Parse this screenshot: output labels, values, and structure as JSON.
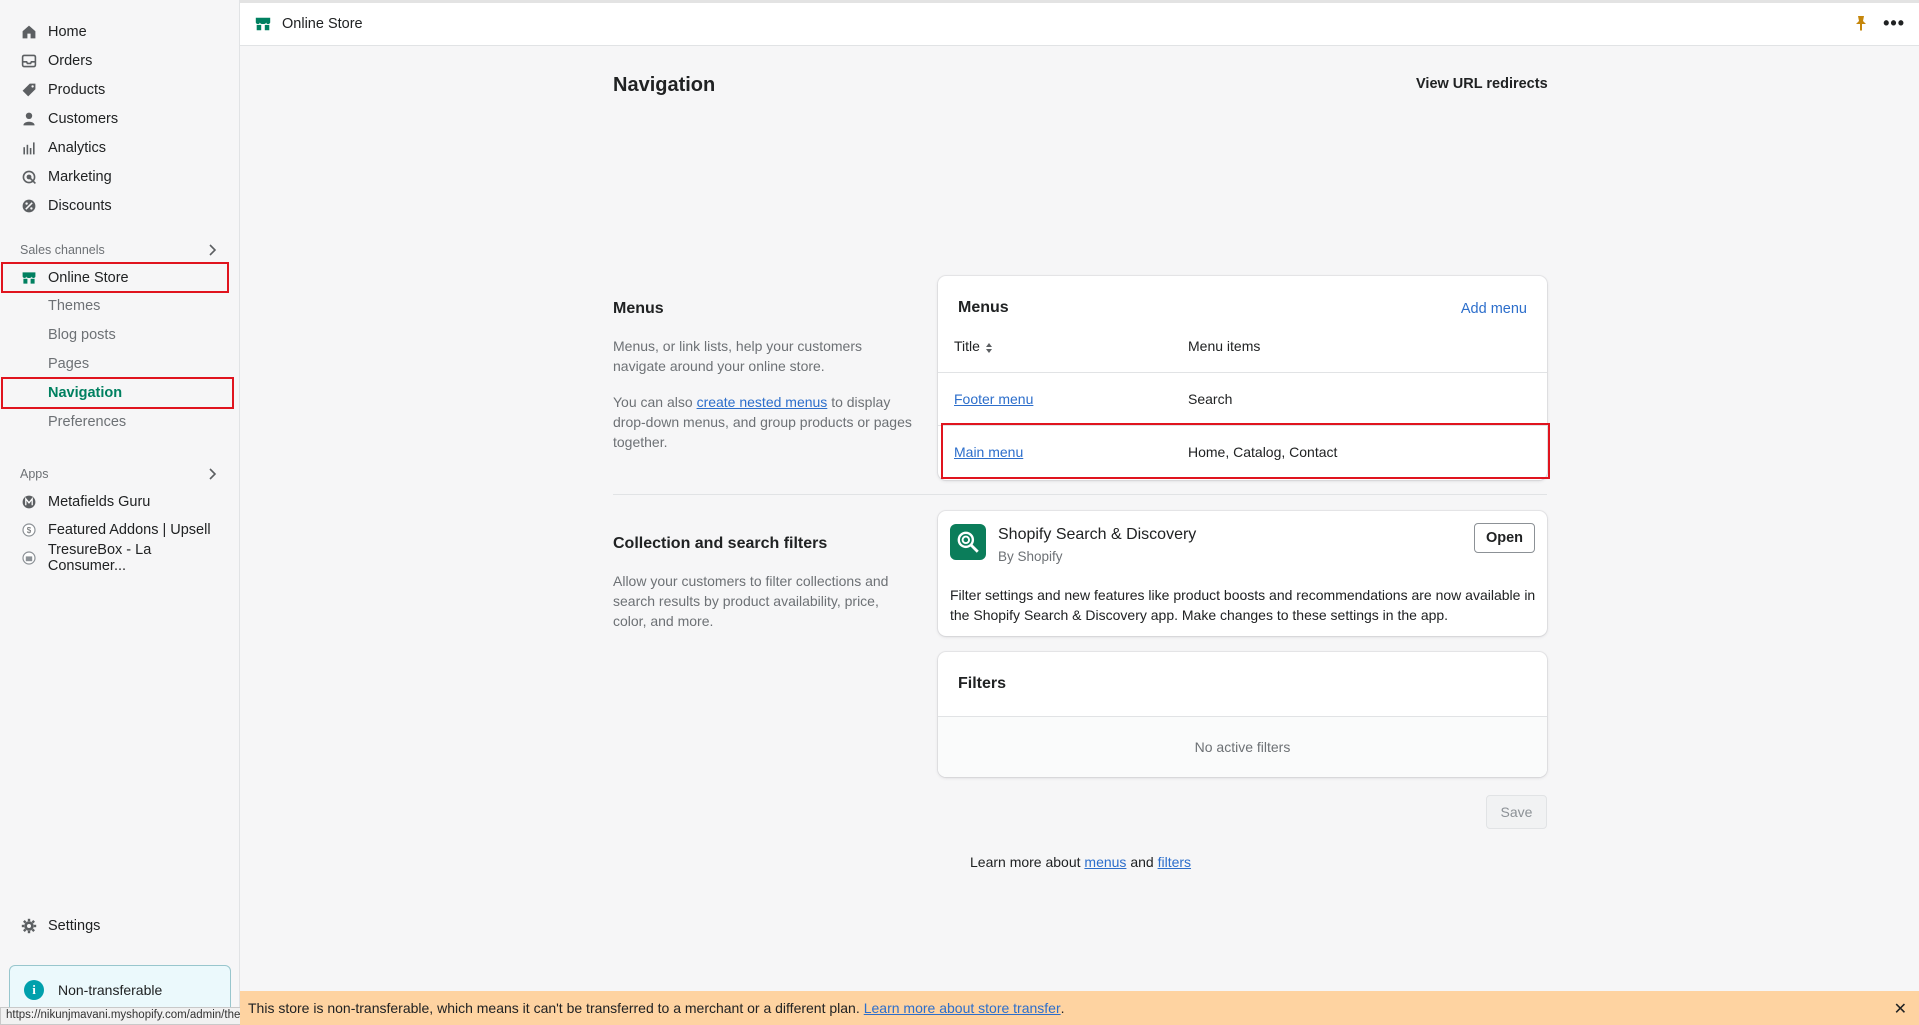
{
  "sidebar": {
    "items": [
      {
        "label": "Home",
        "icon": "home-icon"
      },
      {
        "label": "Orders",
        "icon": "orders-icon"
      },
      {
        "label": "Products",
        "icon": "tag-icon"
      },
      {
        "label": "Customers",
        "icon": "person-icon"
      },
      {
        "label": "Analytics",
        "icon": "bar-chart-icon"
      },
      {
        "label": "Marketing",
        "icon": "target-icon"
      },
      {
        "label": "Discounts",
        "icon": "discount-icon"
      }
    ],
    "sales_channels_label": "Sales channels",
    "online_store": {
      "label": "Online Store",
      "icon": "store-icon"
    },
    "online_store_sub": [
      "Themes",
      "Blog posts",
      "Pages",
      "Navigation",
      "Preferences"
    ],
    "active_sub": "Navigation",
    "apps_label": "Apps",
    "apps": [
      {
        "label": "Metafields Guru",
        "icon": "metafields-icon"
      },
      {
        "label": "Featured Addons | Upsell",
        "icon": "addons-icon"
      },
      {
        "label": "TresureBox - La Consumer...",
        "icon": "tresurebox-icon"
      }
    ],
    "settings_label": "Settings",
    "nontransferable_label": "Non-transferable"
  },
  "status_url": "https://nikunjmavani.myshopify.com/admin/themes",
  "topbar": {
    "title": "Online Store",
    "dots": "•••"
  },
  "page": {
    "title": "Navigation",
    "url_redirects": "View URL redirects"
  },
  "menus_section": {
    "title": "Menus",
    "desc1": "Menus, or link lists, help your customers navigate around your online store.",
    "desc2_prefix": "You can also ",
    "desc2_link": "create nested menus",
    "desc2_suffix": " to display drop-down menus, and group products or pages together."
  },
  "menus_card": {
    "title": "Menus",
    "add_menu": "Add menu",
    "col_title": "Title",
    "col_items": "Menu items",
    "rows": [
      {
        "title": "Footer menu",
        "items": "Search"
      },
      {
        "title": "Main menu",
        "items": "Home, Catalog, Contact"
      }
    ]
  },
  "filters_section": {
    "title": "Collection and search filters",
    "desc": "Allow your customers to filter collections and search results by product availability, price, color, and more."
  },
  "app_card": {
    "name": "Shopify Search & Discovery",
    "by": "By Shopify",
    "open": "Open",
    "desc": "Filter settings and new features like product boosts and recommendations are now available in the Shopify Search & Discovery app. Make changes to these settings in the app."
  },
  "filters_card": {
    "title": "Filters",
    "empty": "No active filters"
  },
  "save_label": "Save",
  "learn_more": {
    "prefix": "Learn more about ",
    "menus": "menus",
    "and": " and ",
    "filters": "filters"
  },
  "banner": {
    "text": "This store is non-transferable, which means it can't be transferred to a merchant or a different plan.",
    "link": "Learn more about store transfer",
    "suffix": ".",
    "close": "✕"
  },
  "colors": {
    "accent": "#008060",
    "link": "#2c6ecb",
    "highlight": "#e0141e",
    "banner": "#fed3a1"
  }
}
